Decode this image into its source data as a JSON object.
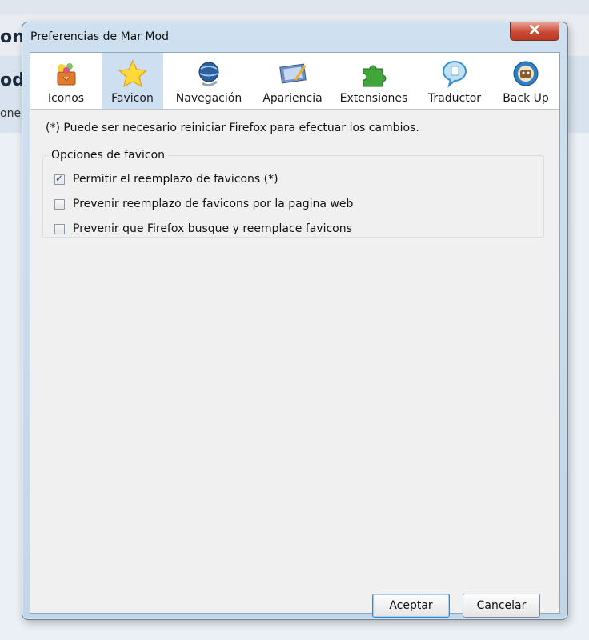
{
  "background": {
    "text_line1": "on",
    "text_line2": "od",
    "text_line3": "one"
  },
  "dialog": {
    "title": "Preferencias de Mar Mod"
  },
  "toolbar": {
    "items": [
      {
        "label": "Iconos",
        "icon": "icons-folder-icon"
      },
      {
        "label": "Favicon",
        "icon": "star-icon"
      },
      {
        "label": "Navegación",
        "icon": "navigation-globe-icon"
      },
      {
        "label": "Apariencia",
        "icon": "appearance-display-icon"
      },
      {
        "label": "Extensiones",
        "icon": "puzzle-icon"
      },
      {
        "label": "Traductor",
        "icon": "speech-bubble-icon"
      },
      {
        "label": "Back Up",
        "icon": "backup-icon"
      }
    ],
    "active": "Favicon"
  },
  "notice": "(*) Puede ser necesario reiniciar Firefox para efectuar los cambios.",
  "options_group": {
    "legend": "Opciones de favicon",
    "options": [
      {
        "label": "Permitir el reemplazo de favicons (*)",
        "checked": true
      },
      {
        "label": "Prevenir reemplazo de favicons por la pagina web",
        "checked": false
      },
      {
        "label": "Prevenir que Firefox busque y reemplace favicons",
        "checked": false
      }
    ]
  },
  "buttons": {
    "accept": "Aceptar",
    "cancel": "Cancelar"
  },
  "colors": {
    "accent": "#3b84c6",
    "active_tab": "#cfdff2",
    "close_button": "#cc4a35"
  }
}
